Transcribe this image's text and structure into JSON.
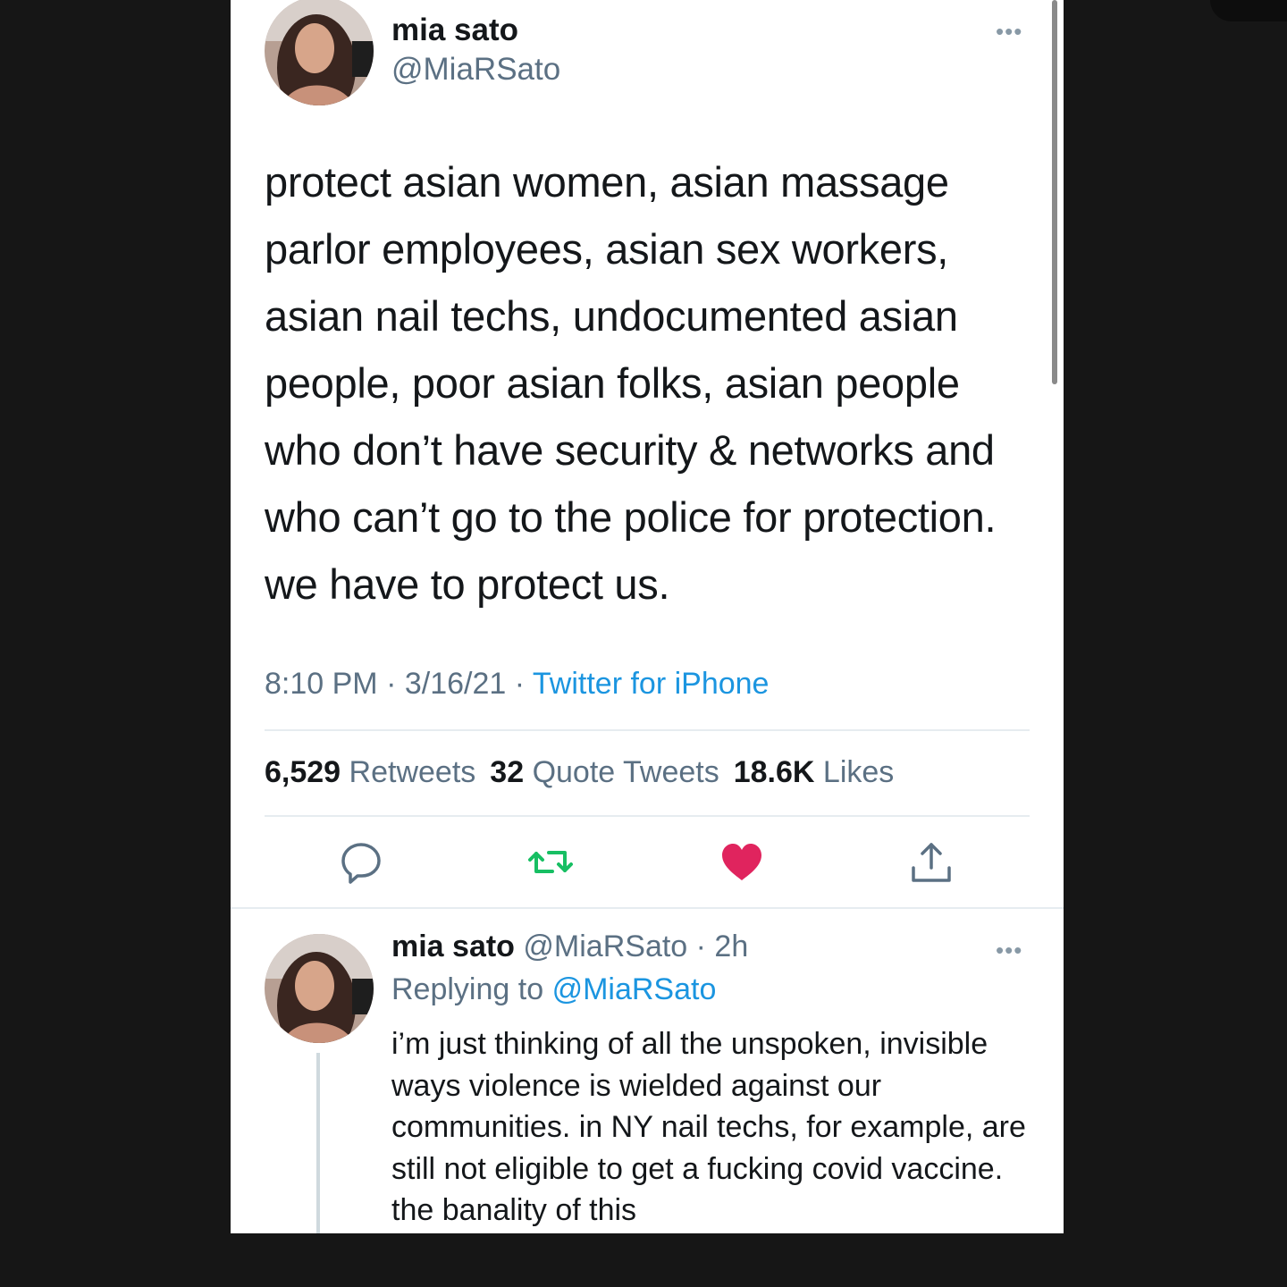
{
  "tweet": {
    "author_name": "mia sato",
    "author_handle": "@MiaRSato",
    "more_label": "•••",
    "text": "protect asian women, asian massage parlor employees, asian sex workers, asian nail techs, undocumented asian people, poor asian folks, asian people who don’t have security & networks and who can’t go to the police for protection. we have to protect us.",
    "time": "8:10 PM",
    "date": "3/16/21",
    "source": "Twitter for iPhone",
    "separator": " · ",
    "stats": {
      "retweets_count": "6,529",
      "retweets_label": "Retweets",
      "quotes_count": "32",
      "quotes_label": "Quote Tweets",
      "likes_count": "18.6K",
      "likes_label": "Likes"
    },
    "actions": {
      "reply_icon": "reply-bubble-icon",
      "retweet_icon": "retweet-arrows-icon",
      "like_icon": "heart-filled-icon",
      "share_icon": "share-upload-icon"
    },
    "colors": {
      "retweet": "#17bf63",
      "like": "#e0245e",
      "link": "#1b95e0"
    }
  },
  "reply": {
    "author_name": "mia sato",
    "author_handle": "@MiaRSato",
    "time_ago": "2h",
    "more_label": "•••",
    "replying_prefix": "Replying to",
    "replying_to": "@MiaRSato",
    "text": "i’m just thinking of all the unspoken, invisible ways violence is wielded against our communities. in NY nail techs, for example, are still not eligible to get a fucking covid vaccine. the banality of this"
  }
}
